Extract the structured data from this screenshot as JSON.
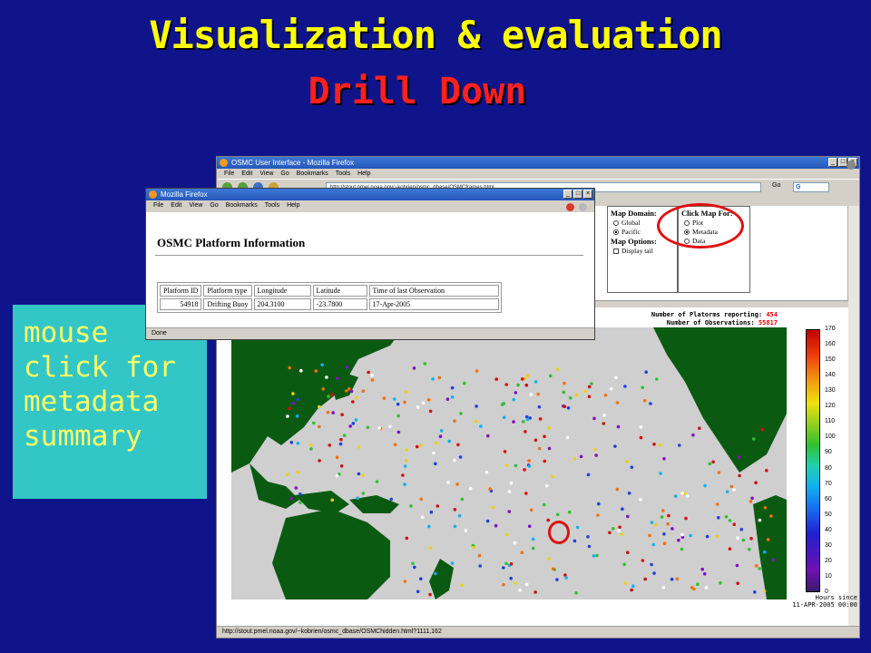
{
  "slide": {
    "title": "Visualization & evaluation",
    "subtitle": "Drill Down",
    "note_lines": [
      "mouse",
      "click for",
      "metadata",
      "summary"
    ]
  },
  "main_window": {
    "title": "OSMC User Interface - Mozilla Firefox",
    "menu": [
      "File",
      "Edit",
      "View",
      "Go",
      "Bookmarks",
      "Tools",
      "Help"
    ],
    "url": "http://stout.pmel.noaa.gov/~kobrien/osmc_dbase/OSMCframes.html",
    "go_label": "Go",
    "search_glyph": "G",
    "map_domain": {
      "heading": "Map Domain:",
      "options": [
        {
          "label": "Global",
          "selected": false
        },
        {
          "label": "Pacific",
          "selected": true
        }
      ]
    },
    "map_options": {
      "heading": "Map Options:",
      "display_tail": "Display tail"
    },
    "click_map": {
      "heading": "Click Map For:",
      "options": [
        {
          "label": "Plot",
          "selected": false
        },
        {
          "label": "Metadata",
          "selected": true
        },
        {
          "label": "Data",
          "selected": false
        }
      ]
    },
    "stats": {
      "platforms_label": "Number of Platorms reporting:",
      "platforms_value": "454",
      "observations_label": "Number of Observations:",
      "observations_value": "55817"
    },
    "colorbar": {
      "ticks": [
        170,
        160,
        150,
        140,
        130,
        120,
        110,
        100,
        90,
        80,
        70,
        60,
        50,
        40,
        30,
        20,
        10,
        0
      ],
      "label_line1": "Hours since",
      "label_line2": "11-APR-2005 00:00"
    },
    "status": "http://stout.pmel.noaa.gov/~kobrien/osmc_dbase/OSMChidden.html?1111,162"
  },
  "popup_window": {
    "title": "Mozilla Firefox",
    "menu": [
      "File",
      "Edit",
      "View",
      "Go",
      "Bookmarks",
      "Tools",
      "Help"
    ],
    "heading": "OSMC Platform Information",
    "table": {
      "headers": [
        "Platform ID",
        "Platform type",
        "Longitude",
        "Latitude",
        "Time of last Observation"
      ],
      "row": [
        "54918",
        "Drifting Buoy",
        "204.3100",
        "-23.7800",
        "17-Apr-2005"
      ]
    },
    "status": "Done"
  },
  "colors": {
    "slide_background": "#10148a",
    "title": "#ffff00",
    "subtitle": "#ff2020",
    "note_background": "#33c6c6",
    "note_text": "#ffff66",
    "highlight_ring": "#e01010",
    "land": "#0b5a12",
    "ocean": "#cfcfcf"
  },
  "icons": [
    "firefox-icon",
    "back-icon",
    "forward-icon",
    "reload-icon",
    "home-icon",
    "stop-icon",
    "throbber-icon"
  ]
}
